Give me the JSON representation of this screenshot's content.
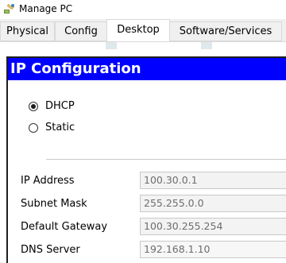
{
  "window": {
    "title": "Manage PC",
    "icon": "pc-app-icon"
  },
  "tabs": [
    {
      "label": "Physical",
      "active": false
    },
    {
      "label": "Config",
      "active": false
    },
    {
      "label": "Desktop",
      "active": true
    },
    {
      "label": "Software/Services",
      "active": false
    }
  ],
  "ip_config": {
    "title": "IP Configuration",
    "mode_options": [
      {
        "label": "DHCP",
        "selected": true
      },
      {
        "label": "Static",
        "selected": false
      }
    ],
    "fields": [
      {
        "label": "IP Address",
        "value": "100.30.0.1"
      },
      {
        "label": "Subnet Mask",
        "value": "255.255.0.0"
      },
      {
        "label": "Default Gateway",
        "value": "100.30.255.254"
      },
      {
        "label": "DNS Server",
        "value": "192.168.1.10"
      }
    ]
  },
  "colors": {
    "header_bg": "#0000ff",
    "header_text": "#ffffff",
    "input_text": "#6d6d6d"
  }
}
